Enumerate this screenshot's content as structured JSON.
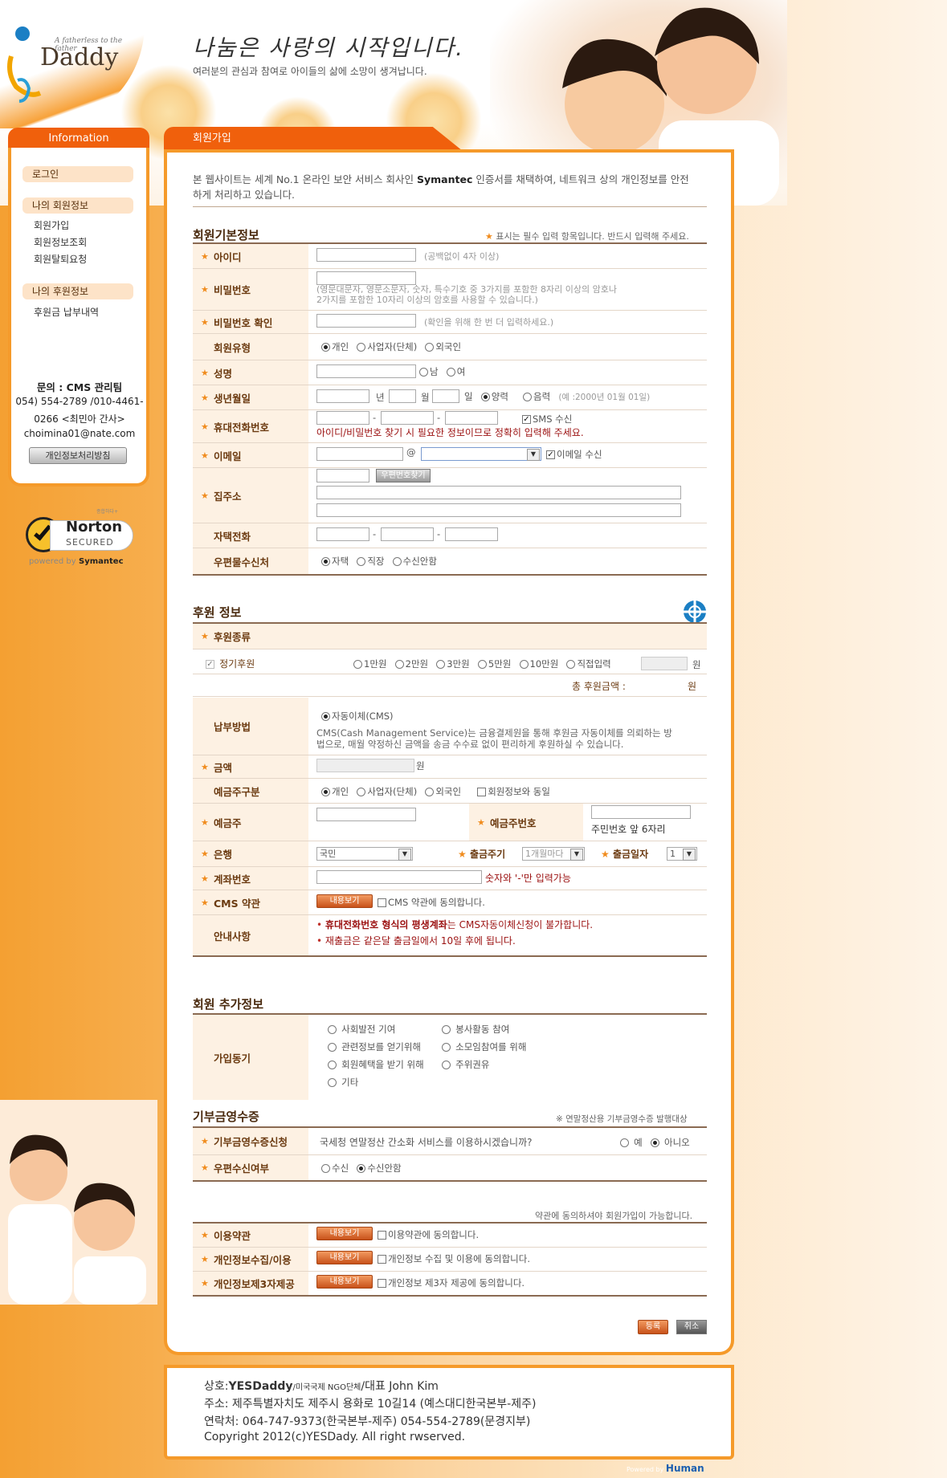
{
  "header": {
    "logo_tagline": "A fatherless to the father",
    "logo_name": "Daddy",
    "slogan": "나눔은 사랑의 시작입니다.",
    "subslogan": "여러분의 관심과 참여로 아이들의 삶에 소망이 생겨납니다."
  },
  "sidebar": {
    "tab": "Information",
    "login": "로그인",
    "my_member": "나의 회원정보",
    "member_items": [
      "회원가입",
      "회원정보조회",
      "회원탈퇴요청"
    ],
    "my_support": "나의 후원정보",
    "support_items": [
      "후원금 납부내역"
    ],
    "contact_title": "문의 : CMS 관리팀",
    "contact_line1": "054) 554-2789 /010-4461-",
    "contact_line2": "0266 <최민아 간사>",
    "contact_email": "choimina01@nate.com",
    "policy_button": "개인정보처리방침",
    "norton_small": "종합하다+",
    "norton_brand": "Norton",
    "norton_secured": "SECURED",
    "norton_powered": "powered by",
    "norton_symantec": "Symantec"
  },
  "main": {
    "tab": "회원가입",
    "intro_a": "본 웹사이트는 세계 No.1 온라인 보안 서비스 회사인 ",
    "intro_brand": "Symantec",
    "intro_b": " 인증서를 채택하여, 네트워크 상의 개인정보를 안전",
    "intro_c": "하게 처리하고 있습니다.",
    "basic_title": "회원기본정보",
    "required_note": "표시는 필수 입력 항목입니다. 반드시 입력해 주세요.",
    "labels": {
      "id": "아이디",
      "pw": "비밀번호",
      "pw_confirm": "비밀번호 확인",
      "member_type": "회원유형",
      "name": "성명",
      "birth": "생년월일",
      "mobile": "휴대전화번호",
      "email": "이메일",
      "address": "집주소",
      "home_phone": "자택전화",
      "mail_dest": "우편물수신처"
    },
    "hints": {
      "id": "(공백없이 4자 이상)",
      "pw1": "(영문대문자, 영문소문자, 숫자, 특수기호 중 3가지를 포함한 8자리 이상의 암호나",
      "pw2": "2가지를 포함한 10자리 이상의 암호를 사용할 수 있습니다.)",
      "pw_confirm": "(확인을 위해 한 번 더 입력하세요.)",
      "mobile_warn": "아이디/비밀번호 찾기 시 필요한 정보이므로 정확히 입력해 주세요.",
      "birth_example": "(예 :2000년 01월 01일)"
    },
    "opts": {
      "individual": "개인",
      "business": "사업자(단체)",
      "foreigner": "외국인",
      "male": "남",
      "female": "여",
      "year": "년",
      "month": "월",
      "day": "일",
      "solar": "양력",
      "lunar": "음력",
      "sms": "SMS 수신",
      "at": "@",
      "email_recv": "이메일 수신",
      "zip_button": "우편번호찾기",
      "dash": "-",
      "home": "자택",
      "work": "직장",
      "no_recv": "수신안함"
    },
    "support_title": "후원 정보",
    "support_kind": "후원종류",
    "regular": "정기후원",
    "amounts": [
      "1만원",
      "2만원",
      "3만원",
      "5만원",
      "10만원",
      "직접입력"
    ],
    "won": "원",
    "total_label": "총 후원금액 :",
    "pay_method": "납부방법",
    "auto_transfer": "자동이체(CMS)",
    "cms_desc1": "CMS(Cash Management Service)는 금융결제원을 통해 후원금 자동이체를 의뢰하는 방",
    "cms_desc2": "법으로, 매월 약정하신 금액을 송금 수수료 없이 편리하게 후원하실 수 있습니다.",
    "amount": "금액",
    "holder_type": "예금주구분",
    "same_as_member": "회원정보와 동일",
    "holder": "예금주",
    "holder_no": "예금주번호",
    "holder_no_hint": "주민번호 앞 6자리",
    "bank": "은행",
    "bank_value": "국민",
    "withdraw_cycle": "출금주기",
    "cycle_value": "1개월마다",
    "withdraw_day": "출금일자",
    "day_value": "1",
    "account": "계좌번호",
    "account_hint": "숫자와 '-'만 입력가능",
    "cms_terms": "CMS 약관",
    "view_button": "내용보기",
    "cms_agree": "CMS 약관에 동의합니다.",
    "notice": "안내사항",
    "notice1a": "휴대전화번호 형식의 평생계좌",
    "notice1b": "는 CMS자동이체신청이 불가합니다.",
    "notice2": "재출금은 같은달 출금일에서 10일 후에 됩니다.",
    "extra_title": "회원 추가정보",
    "join_motive": "가입동기",
    "motives": [
      "사회발전 기여",
      "봉사활동 참여",
      "관련정보를 얻기위해",
      "소모임참여를 위해",
      "회원혜택을 받기 위해",
      "주위권유",
      "기타"
    ],
    "receipt_title": "기부금영수증",
    "receipt_note": "※ 연말정산용 기부금영수증 발행대상",
    "receipt_apply": "기부금영수증신청",
    "receipt_question": "국세청 연말정산 간소화 서비스를 이용하시겠습니까?",
    "yes": "예",
    "no": "아니오",
    "mail_recv": "우편수신여부",
    "recv": "수신",
    "no_recv": "수신안함",
    "terms_note": "약관에 동의하셔야 회원가입이 가능합니다.",
    "terms_use": "이용약관",
    "terms_use_agree": "이용약관에 동의합니다.",
    "terms_privacy": "개인정보수집/이용",
    "terms_privacy_agree": "개인정보 수집 및 이용에 동의합니다.",
    "terms_third": "개인정보제3자제공",
    "terms_third_agree": "개인정보 제3자 제공에 동의합니다.",
    "submit": "등록",
    "cancel": "취소"
  },
  "footer": {
    "l1a": "상호:",
    "l1b": "YESDaddy",
    "l1c": "/미국국제 NGO단체",
    "l1d": "/대표 John Kim",
    "l2": "주소: 제주특별자치도 제주시 용화로 10길14 (예스대디한국본부-제주)",
    "l3": "연락처: 064-747-9373(한국본부-제주) 054-554-2789(문경지부)",
    "l4": "Copyright 2012(c)YESDady. All right rwserved.",
    "powered": "Powered by",
    "human": "Human"
  }
}
